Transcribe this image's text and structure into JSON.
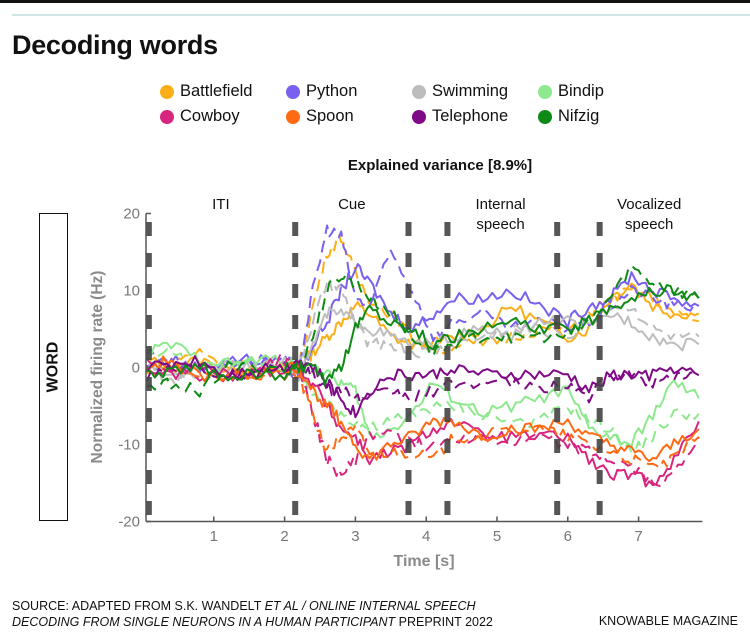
{
  "header": {
    "title": "Decoding words"
  },
  "legend": [
    {
      "label": "Battlefield",
      "color": "#FBAE17"
    },
    {
      "label": "Python",
      "color": "#7A60EE"
    },
    {
      "label": "Swimming",
      "color": "#BDBDBD"
    },
    {
      "label": "Bindip",
      "color": "#8EE88E"
    },
    {
      "label": "Cowboy",
      "color": "#D8257F"
    },
    {
      "label": "Spoon",
      "color": "#FF6A13"
    },
    {
      "label": "Telephone",
      "color": "#7F0A86"
    },
    {
      "label": "Nifzig",
      "color": "#108A16"
    }
  ],
  "side_label": "WORD",
  "footer": {
    "source_prefix": "SOURCE: ADAPTED FROM S.K. WANDELT ",
    "source_italic_1": "ET AL / ONLINE INTERNAL SPEECH",
    "source_italic_2": "DECODING FROM SINGLE NEURONS IN A HUMAN PARTICIPANT",
    "source_suffix": " PREPRINT 2022",
    "brand": "KNOWABLE MAGAZINE"
  },
  "chart_data": {
    "type": "line",
    "title": "Explained variance [8.9%]",
    "xlabel": "Time [s]",
    "ylabel": "Normalized firing rate (Hz)",
    "xlim": [
      0,
      7.9
    ],
    "ylim": [
      -20,
      20
    ],
    "xticks": [
      1,
      2,
      3,
      4,
      5,
      6,
      7
    ],
    "yticks": [
      20,
      10,
      0,
      -10,
      -20
    ],
    "grid": false,
    "phase_boundaries": [
      0.04,
      2.15,
      3.75,
      4.3,
      5.85,
      6.45
    ],
    "phases": [
      {
        "label": "ITI",
        "t": 1.1
      },
      {
        "label": "Cue",
        "t": 2.95
      },
      {
        "label": "Internal\nspeech",
        "t": 5.05
      },
      {
        "label": "Vocalized\nspeech",
        "t": 7.15
      }
    ],
    "x": [
      0.05,
      0.4,
      0.8,
      1.2,
      1.6,
      2.0,
      2.2,
      2.4,
      2.6,
      2.8,
      3.0,
      3.2,
      3.5,
      3.8,
      4.1,
      4.4,
      4.8,
      5.2,
      5.6,
      6.0,
      6.3,
      6.6,
      6.9,
      7.2,
      7.5,
      7.85
    ],
    "series": [
      {
        "name": "Battlefield",
        "style": "solid",
        "values": [
          1,
          0,
          1,
          -0.5,
          0,
          -0.5,
          0,
          2,
          4,
          6,
          8,
          7,
          4,
          3,
          3,
          4,
          5,
          8,
          6,
          4,
          5,
          9,
          11,
          8,
          7,
          7
        ]
      },
      {
        "name": "Battlefield",
        "style": "dashed",
        "values": [
          -1,
          1,
          2,
          0,
          0.5,
          -1,
          0,
          8,
          15,
          17,
          12,
          9,
          7,
          4,
          2,
          3,
          3,
          4,
          5,
          5,
          7,
          9,
          10,
          9,
          7,
          6
        ]
      },
      {
        "name": "Python",
        "style": "solid",
        "values": [
          0,
          0.5,
          0,
          1,
          1,
          0,
          -1,
          3,
          6,
          10,
          13,
          11,
          7,
          5,
          7,
          9,
          9,
          10,
          8,
          6,
          8,
          9,
          12,
          10,
          9,
          8
        ]
      },
      {
        "name": "Python",
        "style": "dashed",
        "values": [
          2,
          1,
          0,
          0.5,
          1,
          1,
          0,
          10,
          18,
          17,
          9,
          8,
          15,
          10,
          4,
          6,
          7,
          5,
          6,
          5,
          6,
          8,
          10,
          9,
          8,
          8
        ]
      },
      {
        "name": "Swimming",
        "style": "solid",
        "values": [
          0,
          -1,
          0,
          1,
          0,
          0.5,
          -1,
          3,
          7,
          7,
          6,
          5,
          4,
          3,
          3,
          4,
          5,
          4,
          6,
          6,
          5,
          7,
          6,
          4,
          3,
          3
        ]
      },
      {
        "name": "Swimming",
        "style": "dashed",
        "values": [
          0,
          -2,
          -1,
          0,
          0.5,
          0,
          0,
          6,
          11,
          10,
          6,
          3,
          3,
          2,
          2,
          3,
          4,
          5,
          5,
          4,
          6,
          8,
          8,
          5,
          4,
          4
        ]
      },
      {
        "name": "Bindip",
        "style": "solid",
        "values": [
          2,
          3,
          1,
          0.5,
          1,
          1,
          0,
          0,
          -1,
          -2,
          -3,
          -9,
          -8,
          -6,
          -2,
          -4,
          -6,
          -5,
          -4,
          -3,
          -8,
          -9,
          -10,
          -6,
          -2,
          -4
        ]
      },
      {
        "name": "Bindip",
        "style": "dashed",
        "values": [
          1,
          2,
          0,
          0,
          1,
          0,
          0,
          -4,
          -5,
          -6,
          -7,
          -8,
          -7,
          -6,
          -5,
          -5,
          -6,
          -7,
          -7,
          -5,
          -7,
          -8,
          -11,
          -9,
          -6,
          -6
        ]
      },
      {
        "name": "Cowboy",
        "style": "solid",
        "values": [
          0,
          -1,
          0,
          -1,
          -1,
          0,
          0,
          -2,
          -5,
          -8,
          -9,
          -12,
          -11,
          -10,
          -8,
          -7,
          -9,
          -9,
          -9,
          -9,
          -12,
          -14,
          -14,
          -15,
          -12,
          -7
        ]
      },
      {
        "name": "Cowboy",
        "style": "dashed",
        "values": [
          1,
          0,
          -1,
          -1,
          0,
          1,
          0,
          -6,
          -12,
          -14,
          -12,
          -9,
          -8,
          -10,
          -10,
          -9,
          -9,
          -10,
          -9,
          -10,
          -11,
          -12,
          -13,
          -15,
          -14,
          -9
        ]
      },
      {
        "name": "Spoon",
        "style": "solid",
        "values": [
          0,
          1,
          -1,
          -1,
          -1,
          0,
          0,
          -3,
          -5,
          -7,
          -10,
          -12,
          -10,
          -9,
          -7,
          -7,
          -9,
          -8,
          -8,
          -7,
          -9,
          -10,
          -11,
          -12,
          -10,
          -8
        ]
      },
      {
        "name": "Spoon",
        "style": "dashed",
        "values": [
          0,
          0,
          -1,
          -1,
          -1,
          -1,
          -1,
          -6,
          -11,
          -9,
          -8,
          -11,
          -11,
          -11,
          -12,
          -9,
          -9,
          -8,
          -8,
          -9,
          -10,
          -11,
          -12,
          -13,
          -12,
          -9
        ]
      },
      {
        "name": "Telephone",
        "style": "solid",
        "values": [
          0,
          0.5,
          1,
          -1,
          0,
          0,
          1,
          0,
          -2,
          -4,
          -6,
          -3,
          -1,
          -1,
          -1,
          0,
          -1,
          -1,
          -1,
          -1,
          -3,
          -1,
          -1,
          -1,
          0,
          -1
        ]
      },
      {
        "name": "Telephone",
        "style": "dashed",
        "values": [
          -1,
          0,
          0,
          -1,
          -1,
          0,
          1,
          -1,
          -3,
          -3,
          -4,
          -4,
          -3,
          -4,
          -3,
          -2,
          -2,
          -2,
          -3,
          -2,
          -4,
          -1,
          -1,
          -2,
          -1,
          -1
        ]
      },
      {
        "name": "Nifzig",
        "style": "solid",
        "values": [
          -1,
          -0.5,
          0,
          -1,
          -1,
          -1,
          0,
          0,
          -2,
          0,
          5,
          8,
          6,
          5,
          3,
          4,
          5,
          6,
          5,
          5,
          6,
          8,
          9,
          10,
          10,
          9
        ]
      },
      {
        "name": "Nifzig",
        "style": "dashed",
        "values": [
          -3,
          -2,
          -3,
          0,
          0,
          0,
          0,
          4,
          10,
          12,
          11,
          9,
          7,
          4,
          2,
          3,
          4,
          4,
          4,
          4,
          6,
          9,
          13,
          11,
          10,
          9
        ]
      }
    ]
  }
}
